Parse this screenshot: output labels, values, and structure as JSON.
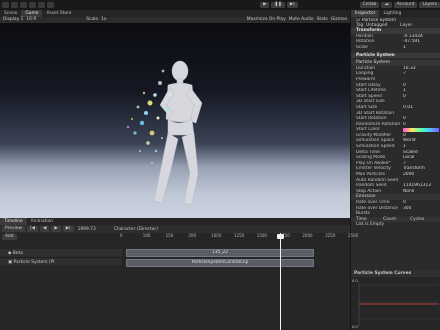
{
  "toolbar": {
    "collab": "Collab",
    "account": "Account",
    "layers": "Layers"
  },
  "tabs_left": [
    {
      "label": "Scene"
    },
    {
      "label": "Game"
    },
    {
      "label": "Asset Store"
    }
  ],
  "scene_toolbar": {
    "display": "Display 1",
    "aspect": "16:9",
    "scale_label": "Scale",
    "scale_value": "1x",
    "maximize": "Maximize On Play",
    "mute": "Mute Audio",
    "stats": "Stats",
    "gizmos": "Gizmos"
  },
  "tabs_right": [
    {
      "label": "Inspector"
    },
    {
      "label": "Lighting"
    }
  ],
  "inspector": {
    "object_name": "Particle System",
    "tag_label": "Tag",
    "tag_value": "Untagged",
    "layer_label": "Layer",
    "transform_header": "Transform",
    "position_label": "Position",
    "position_x": "-0.13434",
    "rotation_label": "Rotation",
    "rotation_x": "-47.591",
    "scale_label": "Scale",
    "scale_x": "1",
    "component_header": "Particle System",
    "module_header": "Particle System",
    "rows": [
      {
        "k": "Duration",
        "v": "10.33"
      },
      {
        "k": "Looping",
        "v": "✓"
      },
      {
        "k": "Prewarm",
        "v": ""
      },
      {
        "k": "Start Delay",
        "v": "0"
      },
      {
        "k": "Start Lifetime",
        "v": "1"
      },
      {
        "k": "Start Speed",
        "v": "0"
      },
      {
        "k": "3D Start Size",
        "v": ""
      },
      {
        "k": "Start Size",
        "v": "0.01"
      },
      {
        "k": "3D Start Rotation",
        "v": ""
      },
      {
        "k": "Start Rotation",
        "v": "0"
      },
      {
        "k": "Randomize Rotation",
        "v": "0"
      },
      {
        "k": "Start Color",
        "v": ""
      },
      {
        "k": "Gravity Modifier",
        "v": "0"
      },
      {
        "k": "Simulation Space",
        "v": "World"
      },
      {
        "k": "Simulation Speed",
        "v": "1"
      },
      {
        "k": "Delta Time",
        "v": "Scaled"
      },
      {
        "k": "Scaling Mode",
        "v": "Local"
      },
      {
        "k": "Play On Awake*",
        "v": "✓"
      },
      {
        "k": "Emitter Velocity",
        "v": "Transform"
      },
      {
        "k": "Max Particles",
        "v": "2000"
      },
      {
        "k": "Auto Random Seed",
        "v": ""
      },
      {
        "k": "Random Seed",
        "v": "1141961313"
      },
      {
        "k": "Stop Action",
        "v": "None"
      }
    ],
    "emission_header": "Emission",
    "emission_rows": [
      {
        "k": "Rate over Time",
        "v": "0"
      },
      {
        "k": "Rate over Distance",
        "v": "300"
      }
    ],
    "bursts_label": "Bursts",
    "bursts_cols": [
      "Time",
      "Count",
      "Cycles"
    ],
    "list_empty": "List is Empty"
  },
  "curves": {
    "title": "Particle System Curves",
    "y_top": "0.0",
    "y_bottom": "0.0"
  },
  "timeline": {
    "tab_timeline": "Timeline",
    "tab_animation": "Animation",
    "preview": "Preview",
    "add": "Add",
    "frame": "1999.73",
    "director": "Character (Director)",
    "ruler": [
      "0",
      "100",
      "150",
      "200",
      "1000",
      "1250",
      "1500",
      "1750",
      "2000",
      "2250",
      "2500"
    ],
    "tracks": [
      {
        "label": "Beta",
        "clip": "135_22"
      },
      {
        "label": "Particle System (Pl",
        "clip": "ParticleSystemControlClip"
      }
    ]
  }
}
